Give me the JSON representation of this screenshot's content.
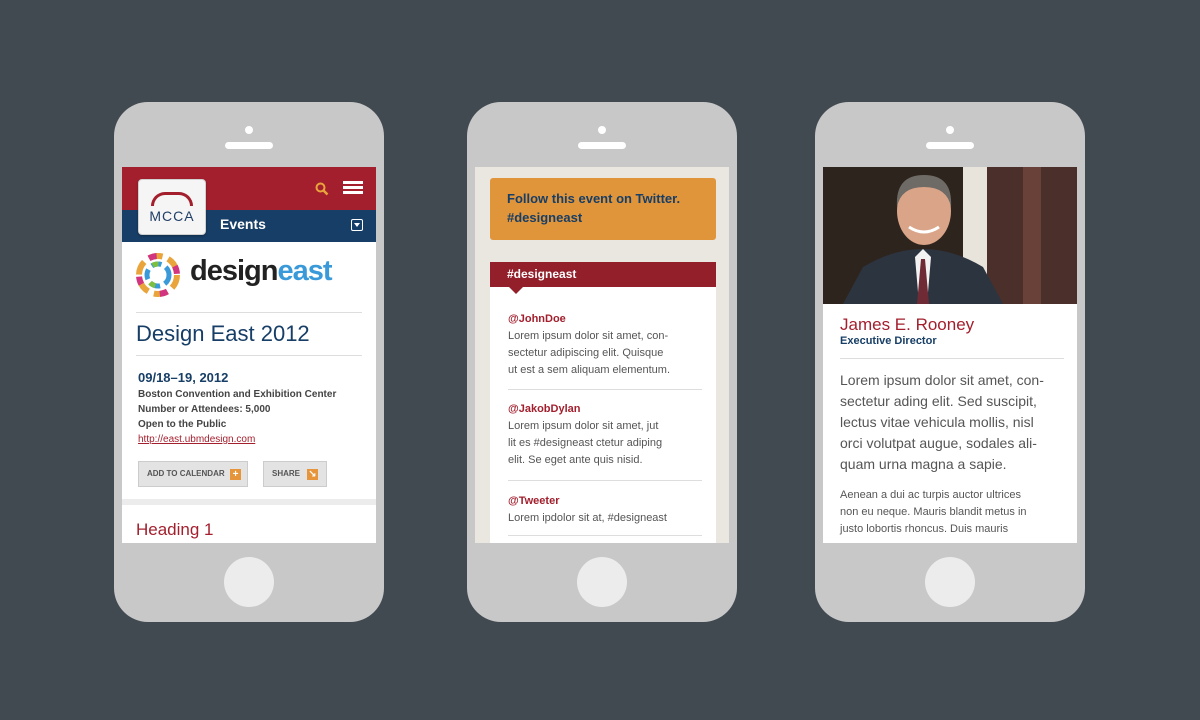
{
  "phone1": {
    "logo_text": "MCCA",
    "nav_label": "Events",
    "brand": {
      "part1": "design",
      "part2": "east"
    },
    "event_title": "Design East 2012",
    "date": "09/18–19, 2012",
    "venue": "Boston Convention and Exhibition Center",
    "attendees": "Number or Attendees: 5,000",
    "access": "Open to the Public",
    "url": "http://east.ubmdesign.com",
    "add_calendar": "ADD TO CALENDAR",
    "share": "SHARE",
    "heading": "Heading 1",
    "colors": {
      "header_red": "#a31f2d",
      "header_blue": "#173e66",
      "accent_orange": "#e1953b"
    }
  },
  "phone2": {
    "banner_line1": "Follow this event on Twitter.",
    "banner_line2": "#designeast",
    "tag_header": "#designeast",
    "tweets": [
      {
        "handle": "@JohnDoe",
        "lines": [
          "Lorem ipsum dolor sit amet, con-",
          "sectetur adipiscing elit. Quisque",
          "ut est a sem aliquam elementum."
        ]
      },
      {
        "handle": "@JakobDylan",
        "lines": [
          "Lorem ipsum dolor sit amet, jut",
          "lit es #designeast ctetur adiping",
          "elit. Se eget ante quis nisid."
        ]
      },
      {
        "handle": "@Tweeter",
        "lines": [
          "Lorem ipdolor sit at, #designeast"
        ]
      }
    ]
  },
  "phone3": {
    "name": "James E. Rooney",
    "role": "Executive Director",
    "lead_lines": [
      "Lorem ipsum dolor sit amet, con-",
      "sectetur ading elit. Sed suscipit,",
      "lectus vitae vehicula mollis, nisl",
      "orci volutpat augue, sodales ali-",
      "quam urna magna a sapie."
    ],
    "body_lines": [
      "Aenean a dui ac turpis auctor ultrices",
      "non eu neque. Mauris blandit metus in",
      "justo lobortis rhoncus. Duis mauris"
    ]
  }
}
